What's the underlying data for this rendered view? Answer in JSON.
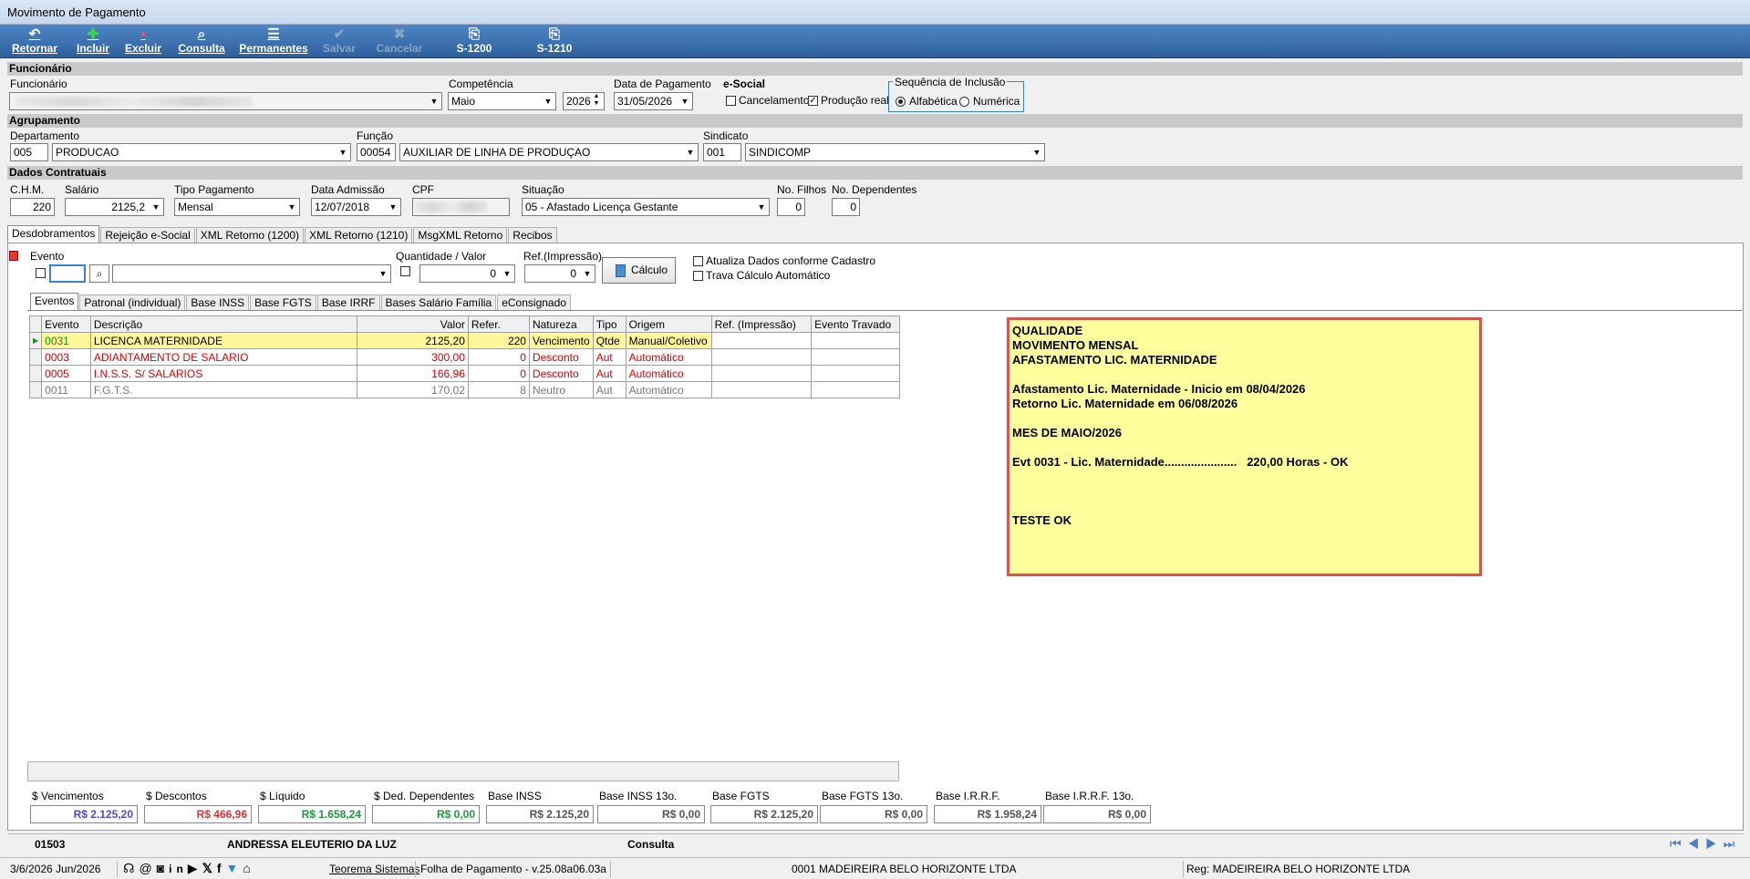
{
  "window": {
    "title": "Movimento de Pagamento"
  },
  "toolbar": {
    "retornar": "Retornar",
    "incluir": "Incluir",
    "excluir": "Excluir",
    "consulta": "Consulta",
    "permanentes": "Permanentes",
    "salvar": "Salvar",
    "cancelar": "Cancelar",
    "s1200": "S-1200",
    "s1210": "S-1210"
  },
  "sections": {
    "funcionario": "Funcionário",
    "agrupamento": "Agrupamento",
    "dados_contratuais": "Dados Contratuais"
  },
  "funcionario": {
    "label": "Funcionário",
    "competencia_label": "Competência",
    "competencia_mes": "Maio",
    "competencia_ano": "2026",
    "data_pagamento_label": "Data de Pagamento",
    "data_pagamento": "31/05/2026",
    "esocial_label": "e-Social",
    "cancelamento": "Cancelamento",
    "producao_real": "Produção real",
    "sequencia_label": "Sequência de Inclusão",
    "alfabetica": "Alfabética",
    "numerica": "Numérica"
  },
  "agrupamento": {
    "departamento_label": "Departamento",
    "departamento_cod": "005",
    "departamento_nome": "PRODUCAO",
    "funcao_label": "Função",
    "funcao_cod": "00054",
    "funcao_nome": "AUXILIAR DE LINHA DE PRODUÇAO",
    "sindicato_label": "Sindicato",
    "sindicato_cod": "001",
    "sindicato_nome": "SINDICOMP"
  },
  "contratuais": {
    "chm_label": "C.H.M.",
    "chm": "220",
    "salario_label": "Salário",
    "salario": "2125,2",
    "tipo_pagamento_label": "Tipo Pagamento",
    "tipo_pagamento": "Mensal",
    "data_admissao_label": "Data Admissão",
    "data_admissao": "12/07/2018",
    "cpf_label": "CPF",
    "situacao_label": "Situação",
    "situacao": "05 - Afastado Licença Gestante",
    "filhos_label": "No. Filhos",
    "filhos": "0",
    "dependentes_label": "No. Dependentes",
    "dependentes": "0"
  },
  "main_tabs": [
    "Desdobramentos",
    "Rejeição e-Social",
    "XML Retorno (1200)",
    "XML Retorno (1210)",
    "MsgXML Retorno",
    "Recibos"
  ],
  "evento_form": {
    "evento_label": "Evento",
    "quantidade_label": "Quantidade / Valor",
    "quantidade": "0",
    "ref_label": "Ref.(Impressão)",
    "ref": "0",
    "calculo": "Cálculo",
    "atualiza": "Atualiza Dados conforme Cadastro",
    "trava": "Trava Cálculo Automático"
  },
  "sub_tabs": [
    "Eventos",
    "Patronal (individual)",
    "Base INSS",
    "Base FGTS",
    "Base IRRF",
    "Bases Salário Família",
    "eConsignado"
  ],
  "grid": {
    "headers": [
      "Evento",
      "Descrição",
      "Valor",
      "Refer.",
      "Natureza",
      "Tipo",
      "Origem",
      "Ref. (Impressão)",
      "Evento Travado"
    ],
    "rows": [
      [
        "0031",
        "LICENCA MATERNIDADE",
        "2125,20",
        "220",
        "Vencimento",
        "Qtde",
        "Manual/Coletivo",
        "",
        ""
      ],
      [
        "0003",
        "ADIANTAMENTO DE SALARIO",
        "300,00",
        "0",
        "Desconto",
        "Aut",
        "Automático",
        "",
        ""
      ],
      [
        "0005",
        "I.N.S.S. S/ SALARIOS",
        "166,96",
        "0",
        "Desconto",
        "Aut",
        "Automático",
        "",
        ""
      ],
      [
        "0011",
        "F.G.T.S.",
        "170,02",
        "8",
        "Neutro",
        "Aut",
        "Automático",
        "",
        ""
      ]
    ]
  },
  "note": {
    "lines": [
      "QUALIDADE",
      "MOVIMENTO MENSAL",
      "AFASTAMENTO LIC. MATERNIDADE",
      "",
      "Afastamento Lic. Maternidade - Inicio em 08/04/2026",
      "Retorno Lic. Maternidade em 06/08/2026",
      "",
      "MES DE MAIO/2026",
      "",
      "Evt 0031 - Lic. Maternidade......................   220,00 Horas - OK",
      "",
      "",
      "",
      "TESTE OK"
    ]
  },
  "totals": [
    {
      "label": "$ Vencimentos",
      "value": "R$ 2.125,20",
      "color": "#4a4ae0"
    },
    {
      "label": "$ Descontos",
      "value": "R$ 466,96",
      "color": "#e03030"
    },
    {
      "label": "$ Líquido",
      "value": "R$ 1.658,24",
      "color": "#1a9a3a"
    },
    {
      "label": "$ Ded. Dependentes",
      "value": "R$ 0,00",
      "color": "#1a9a3a"
    },
    {
      "label": "Base INSS",
      "value": "R$ 2.125,20",
      "color": "#555555"
    },
    {
      "label": "Base INSS 13o.",
      "value": "R$ 0,00",
      "color": "#555555"
    },
    {
      "label": "Base FGTS",
      "value": "R$ 2.125,20",
      "color": "#555555"
    },
    {
      "label": "Base FGTS 13o.",
      "value": "R$ 0,00",
      "color": "#555555"
    },
    {
      "label": "Base I.R.R.F.",
      "value": "R$ 1.958,24",
      "color": "#555555"
    },
    {
      "label": "Base I.R.R.F. 13o.",
      "value": "R$ 0,00",
      "color": "#555555"
    }
  ],
  "record_bar": {
    "codigo": "01503",
    "nome": "ANDRESSA ELEUTERIO DA LUZ",
    "modo": "Consulta"
  },
  "statusbar": {
    "date": "3/6/2026 Jun/2026",
    "company_link": "Teorema Sistemas",
    "version": "Folha de Pagamento - v.25.08a06.03a",
    "empresa": "0001 MADEIREIRA BELO HORIZONTE LTDA",
    "reg": "Reg: MADEIREIRA BELO HORIZONTE LTDA"
  }
}
